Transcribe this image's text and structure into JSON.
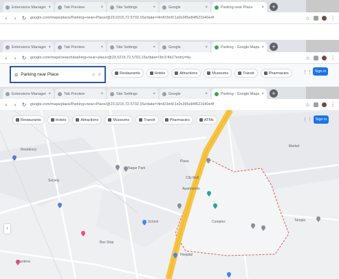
{
  "windows": [
    {
      "tabs": [
        {
          "label": "Extensions Manager"
        },
        {
          "label": "Tab Preview"
        },
        {
          "label": "Site Settings"
        },
        {
          "label": "Google"
        },
        {
          "label": "Parking near Place",
          "active": true
        }
      ],
      "url": "google.com/maps/place/Parking+near+Place/@23.0215,72.5702,15z/data=!4m6!3m5!1s0x395e84f521640e4f"
    },
    {
      "tabs": [
        {
          "label": "Extensions Manager"
        },
        {
          "label": "Tab Preview"
        },
        {
          "label": "Site Settings"
        },
        {
          "label": "Google"
        },
        {
          "label": "Parking - Google Maps",
          "active": true
        }
      ],
      "url": "google.com/maps/search/parking+near+place/@23.0215,72.5702,15z/data=!3m1!4b1?entry=ttu"
    },
    {
      "tabs": [
        {
          "label": "Extensions Manager"
        },
        {
          "label": "Tab Preview"
        },
        {
          "label": "Site Settings"
        },
        {
          "label": "Google"
        },
        {
          "label": "Parking - Google Maps",
          "active": true
        }
      ],
      "url": "google.com/maps/place/Parking+near+Place/@23.0215,72.5702,16z/data=!4m6!3m5!1s0x395e84f521640e4f"
    }
  ],
  "search": {
    "query": "Parking near Place",
    "menu_icon": "menu-icon",
    "search_icon": "search-icon",
    "clear_icon": "close-icon"
  },
  "category_chips_top": [
    "Restaurants",
    "Hotels",
    "Attractions",
    "Museums",
    "Transit",
    "Pharmacies"
  ],
  "category_chips": [
    "Restaurants",
    "Hotels",
    "Attractions",
    "Museums",
    "Transit",
    "Pharmacies",
    "ATMs"
  ],
  "signin": "Sign in",
  "map": {
    "places": [
      {
        "label": "Residency"
      },
      {
        "label": "Society"
      },
      {
        "label": "Nagar Park"
      },
      {
        "label": "Plaza"
      },
      {
        "label": "City Mall"
      },
      {
        "label": "Apartments"
      },
      {
        "label": "School"
      },
      {
        "label": "Bus Stop"
      },
      {
        "label": "Gardens"
      },
      {
        "label": "Complex"
      },
      {
        "label": "Hospital"
      },
      {
        "label": "Temple"
      },
      {
        "label": "Market"
      }
    ]
  },
  "colors": {
    "tabbar": "#dfe3e8",
    "highway": "#f6c343",
    "boundary": "#e05a4a",
    "link_blue": "#1a73e8",
    "search_border": "#2b57a8"
  }
}
